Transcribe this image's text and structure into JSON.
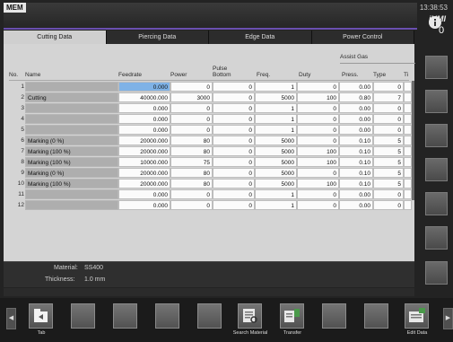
{
  "header": {
    "mode": "MEM",
    "time": "13:38:53",
    "logo": "iHMI",
    "info_badge": "0"
  },
  "tabs": [
    "Cutting Data",
    "Piercing Data",
    "Edge Data",
    "Power Control"
  ],
  "active_tab": "Cutting Data",
  "table": {
    "columns": {
      "no": "No.",
      "name": "Name",
      "feedrate": "Feedrate",
      "power": "Power",
      "pulse_bottom": "Pulse Bottom",
      "freq": "Freq.",
      "duty": "Duty",
      "assist_gas": "Assist Gas",
      "press": "Press.",
      "type": "Type",
      "ti": "Ti"
    },
    "rows": [
      {
        "no": "1",
        "name": "",
        "feedrate": "0.000",
        "power": "0",
        "pulse": "0",
        "freq": "1",
        "duty": "0",
        "press": "0.00",
        "type": "0"
      },
      {
        "no": "2",
        "name": "Cutting",
        "feedrate": "40000.000",
        "power": "3000",
        "pulse": "0",
        "freq": "5000",
        "duty": "100",
        "press": "0.80",
        "type": "7"
      },
      {
        "no": "3",
        "name": "",
        "feedrate": "0.000",
        "power": "0",
        "pulse": "0",
        "freq": "1",
        "duty": "0",
        "press": "0.00",
        "type": "0"
      },
      {
        "no": "4",
        "name": "",
        "feedrate": "0.000",
        "power": "0",
        "pulse": "0",
        "freq": "1",
        "duty": "0",
        "press": "0.00",
        "type": "0"
      },
      {
        "no": "5",
        "name": "",
        "feedrate": "0.000",
        "power": "0",
        "pulse": "0",
        "freq": "1",
        "duty": "0",
        "press": "0.00",
        "type": "0"
      },
      {
        "no": "6",
        "name": "Marking (0 %)",
        "feedrate": "20000.000",
        "power": "80",
        "pulse": "0",
        "freq": "5000",
        "duty": "0",
        "press": "0.10",
        "type": "5"
      },
      {
        "no": "7",
        "name": "Marking (100 %)",
        "feedrate": "20000.000",
        "power": "80",
        "pulse": "0",
        "freq": "5000",
        "duty": "100",
        "press": "0.10",
        "type": "5"
      },
      {
        "no": "8",
        "name": "Marking (100 %)",
        "feedrate": "10000.000",
        "power": "75",
        "pulse": "0",
        "freq": "5000",
        "duty": "100",
        "press": "0.10",
        "type": "5"
      },
      {
        "no": "9",
        "name": "Marking (0 %)",
        "feedrate": "20000.000",
        "power": "80",
        "pulse": "0",
        "freq": "5000",
        "duty": "0",
        "press": "0.10",
        "type": "5"
      },
      {
        "no": "10",
        "name": "Marking (100 %)",
        "feedrate": "20000.000",
        "power": "80",
        "pulse": "0",
        "freq": "5000",
        "duty": "100",
        "press": "0.10",
        "type": "5"
      },
      {
        "no": "11",
        "name": "",
        "feedrate": "0.000",
        "power": "0",
        "pulse": "0",
        "freq": "1",
        "duty": "0",
        "press": "0.00",
        "type": "0"
      },
      {
        "no": "12",
        "name": "",
        "feedrate": "0.000",
        "power": "0",
        "pulse": "0",
        "freq": "1",
        "duty": "0",
        "press": "0.00",
        "type": "0"
      }
    ]
  },
  "material": {
    "material_label": "Material:",
    "material_value": "SS400",
    "thickness_label": "Thickness:",
    "thickness_value": "1.0 mm"
  },
  "softkeys": {
    "tab": "Tab",
    "search_material": "Search Material",
    "transfer": "Transfer",
    "edit_data": "Edit Data"
  },
  "colors": {
    "selected_cell": "#7fb2e6",
    "title_accent": "#6a4fb0"
  }
}
